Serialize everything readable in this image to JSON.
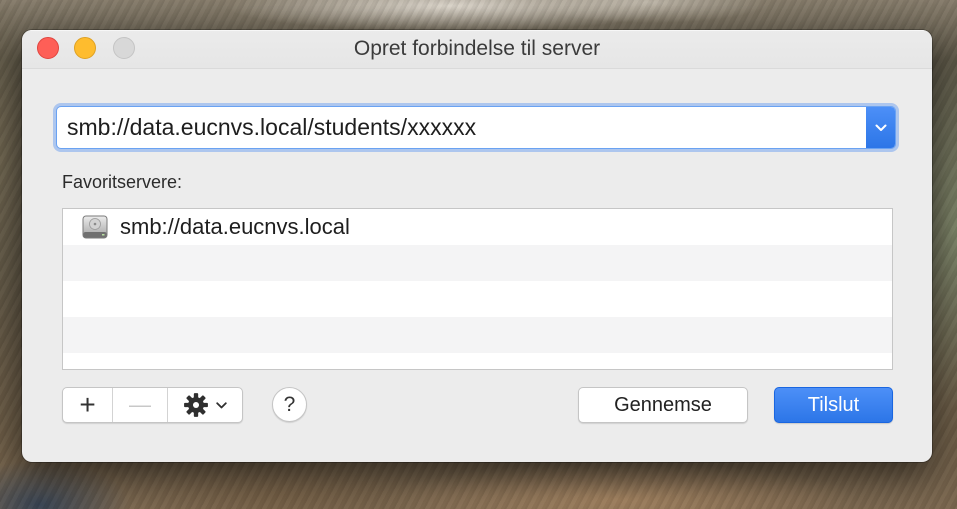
{
  "window": {
    "title": "Opret forbindelse til server",
    "close_color": "#fe5f57",
    "minimize_color": "#febc2e",
    "zoom_color": "#d8d8d8",
    "zoom_enabled": false
  },
  "address": {
    "value": "smb://data.eucnvs.local/students/xxxxxx",
    "dropdown_icon": "chevron-down-icon"
  },
  "favorites": {
    "label": "Favoritservere:",
    "items": [
      {
        "label": "smb://data.eucnvs.local",
        "icon": "hard-drive-icon"
      }
    ]
  },
  "toolbar": {
    "add_label": "+",
    "remove_label": "—",
    "remove_enabled": false,
    "action_icon": "gear-icon",
    "action_menu_icon": "chevron-down-icon",
    "help_label": "?"
  },
  "buttons": {
    "browse_label": "Gennemse",
    "connect_label": "Tilslut"
  },
  "colors": {
    "accent": "#2f7df6",
    "window_background": "#ececec"
  }
}
